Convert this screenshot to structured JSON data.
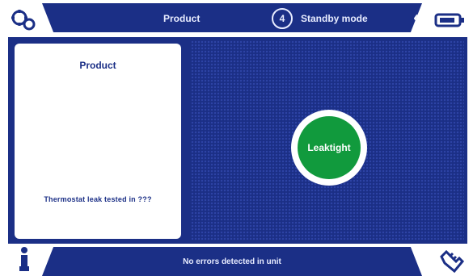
{
  "header": {
    "title": "Product",
    "step_number": "4",
    "mode": "Standby mode",
    "nav_prev": "‹",
    "nav_next": "›"
  },
  "panel": {
    "title": "Product",
    "info": "Thermostat leak tested in ???"
  },
  "status": {
    "result": "Leaktight",
    "color": "#119a3d"
  },
  "footer": {
    "message": "No errors detected in unit"
  },
  "icons": {
    "top_left": "gears-icon",
    "top_right": "battery-icon",
    "bottom_left": "person-icon",
    "bottom_right": "hand-icon"
  },
  "colors": {
    "primary": "#1b2f86",
    "panel": "#ffffff"
  }
}
